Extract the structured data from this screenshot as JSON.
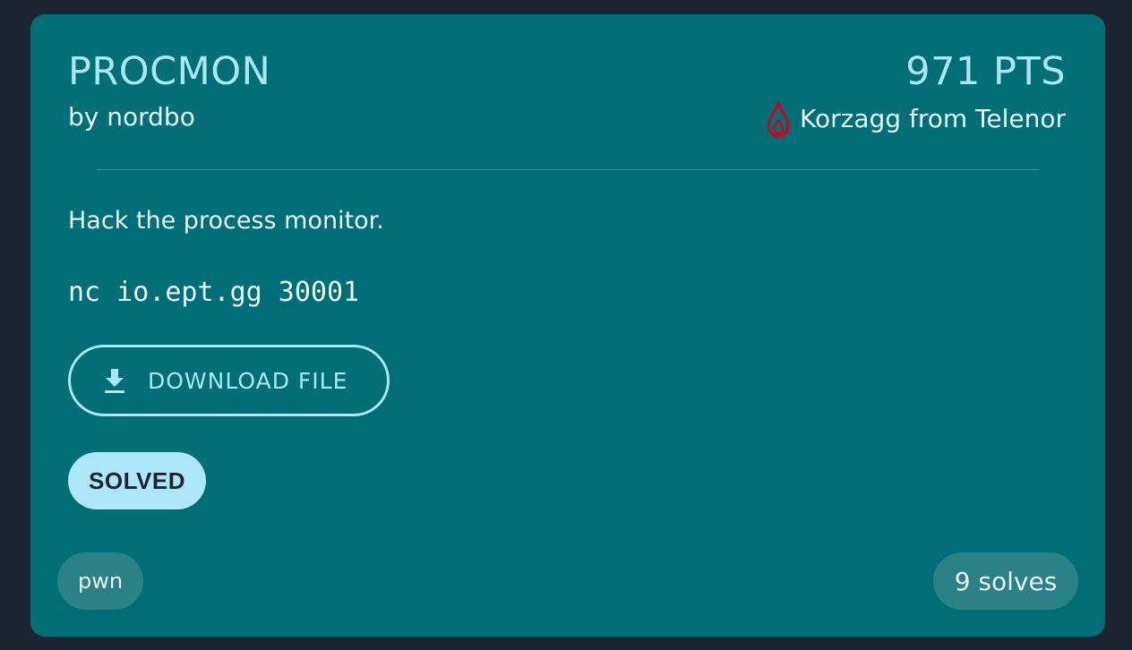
{
  "challenge": {
    "title": "PROCMON",
    "author": "by nordbo",
    "points": "971 PTS",
    "first_blood": "Korzagg from Telenor",
    "description": "Hack the process monitor.",
    "command": "nc io.ept.gg 30001",
    "download_label": "DOWNLOAD FILE",
    "status": "SOLVED",
    "category": "pwn",
    "solves": "9 solves"
  },
  "colors": {
    "page_background": "#1b2430",
    "card_background": "#006e76",
    "accent": "#a9e8f3",
    "first_blood": "#d0021b",
    "solved_badge": "#aee6fb"
  },
  "icons": {
    "first_blood": "drop-icon",
    "download": "download-icon"
  }
}
